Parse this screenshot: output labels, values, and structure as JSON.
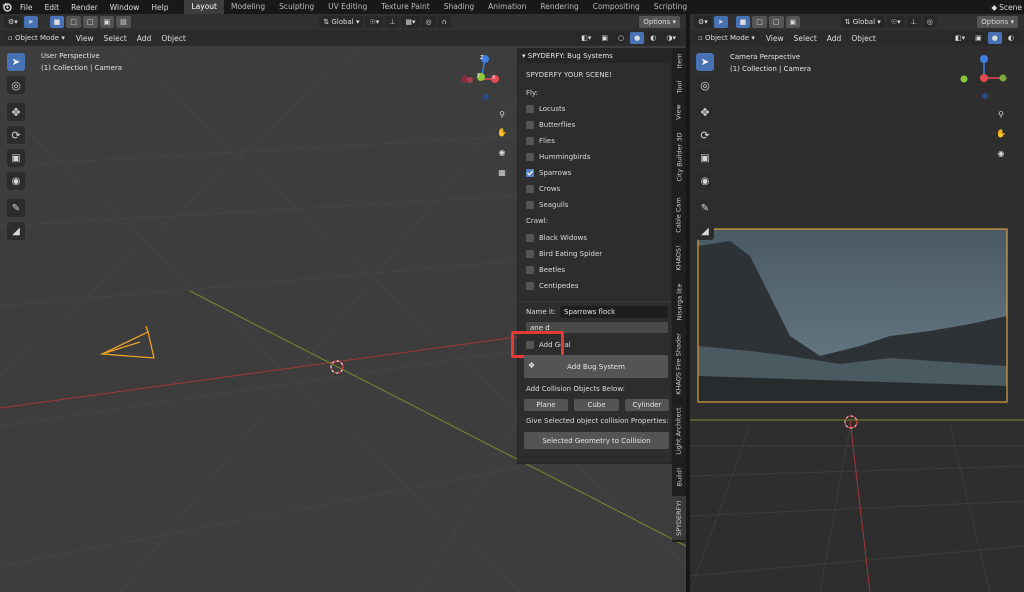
{
  "menu": {
    "file": "File",
    "edit": "Edit",
    "render": "Render",
    "window": "Window",
    "help": "Help"
  },
  "workspaces": [
    "Layout",
    "Modeling",
    "Sculpting",
    "UV Editing",
    "Texture Paint",
    "Shading",
    "Animation",
    "Rendering",
    "Compositing",
    "Scripting"
  ],
  "scene_label": "Scene",
  "left_viewport": {
    "header": {
      "orientation": "Global",
      "options": "Options",
      "mode": "Object Mode",
      "view": "View",
      "select": "Select",
      "add": "Add",
      "object": "Object"
    },
    "perspective": "User Perspective",
    "collection": "(1) Collection | Camera"
  },
  "gizmo": {
    "z": "Z",
    "y": "Y",
    "x": "X"
  },
  "panel": {
    "title": "SPYDERFY: Bug Systems",
    "intro": "SPYDERFY YOUR SCENE!",
    "fly_label": "Fly:",
    "fly": [
      {
        "label": "Locusts",
        "checked": false
      },
      {
        "label": "Butterflies",
        "checked": false
      },
      {
        "label": "Flies",
        "checked": false
      },
      {
        "label": "Hummingbirds",
        "checked": false
      },
      {
        "label": "Sparrows",
        "checked": true
      },
      {
        "label": "Crows",
        "checked": false
      },
      {
        "label": "Seagulls",
        "checked": false
      }
    ],
    "crawl_label": "Crawl:",
    "crawl": [
      {
        "label": "Black Widows",
        "checked": false
      },
      {
        "label": "Bird Eating Spider",
        "checked": false
      },
      {
        "label": "Beetles",
        "checked": false
      },
      {
        "label": "Centipedes",
        "checked": false
      }
    ],
    "name_label": "Name it:",
    "name_value": "Sparrows flock",
    "sub_value": "ane d",
    "add_goal": "Add Goal",
    "add_bug_system": "Add Bug System",
    "collision_label": "Add Collision Objects Below:",
    "plane": "Plane",
    "cube": "Cube",
    "cylinder": "Cylinder",
    "give_label": "Give Selected object collision Properties:",
    "selected_geometry": "Selected Geometry to Collision"
  },
  "tabs": [
    "Item",
    "Tool",
    "View",
    "City Builder 3D",
    "Cable Cam",
    "KHAOS!",
    "Nisarga lite",
    "KHAOS Fire Shader",
    "Light Architect",
    "Build!",
    "SPYDERFY!"
  ],
  "right_viewport": {
    "header": {
      "orientation": "Global",
      "options": "Options",
      "mode": "Object Mode",
      "view": "View",
      "select": "Select",
      "add": "Add",
      "object": "Object"
    },
    "perspective": "Camera Perspective",
    "collection": "(1) Collection | Camera"
  },
  "colors": {
    "accent": "#4772b3",
    "highlight": "#e53935",
    "camera": "#f5a623",
    "x_axis": "#e74856",
    "y_axis": "#8ac83c",
    "z_axis": "#3f7fe3"
  }
}
